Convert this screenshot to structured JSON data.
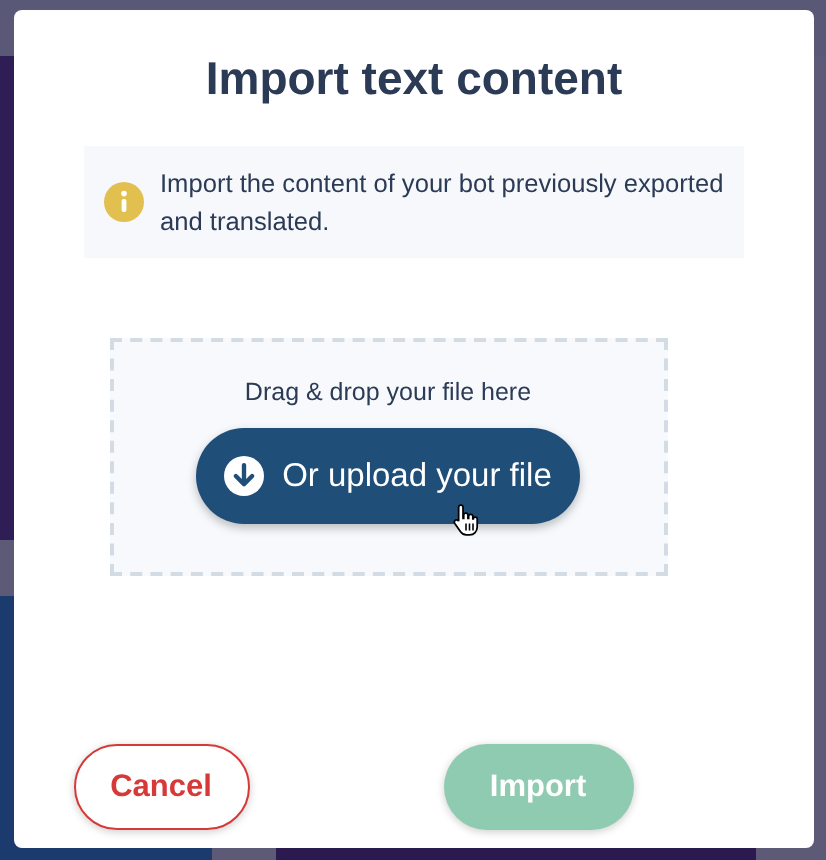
{
  "dialog": {
    "title": "Import text content",
    "notice": {
      "kind": "info",
      "text": "Import the content of your bot previously exported and translated."
    },
    "dropzone": {
      "hint": "Drag & drop your file here",
      "upload_button": "Or upload your file"
    },
    "buttons": [
      {
        "kind": "cancel",
        "label": "Cancel",
        "disabled": false
      },
      {
        "kind": "primary",
        "label": "Import",
        "disabled": true
      }
    ]
  }
}
